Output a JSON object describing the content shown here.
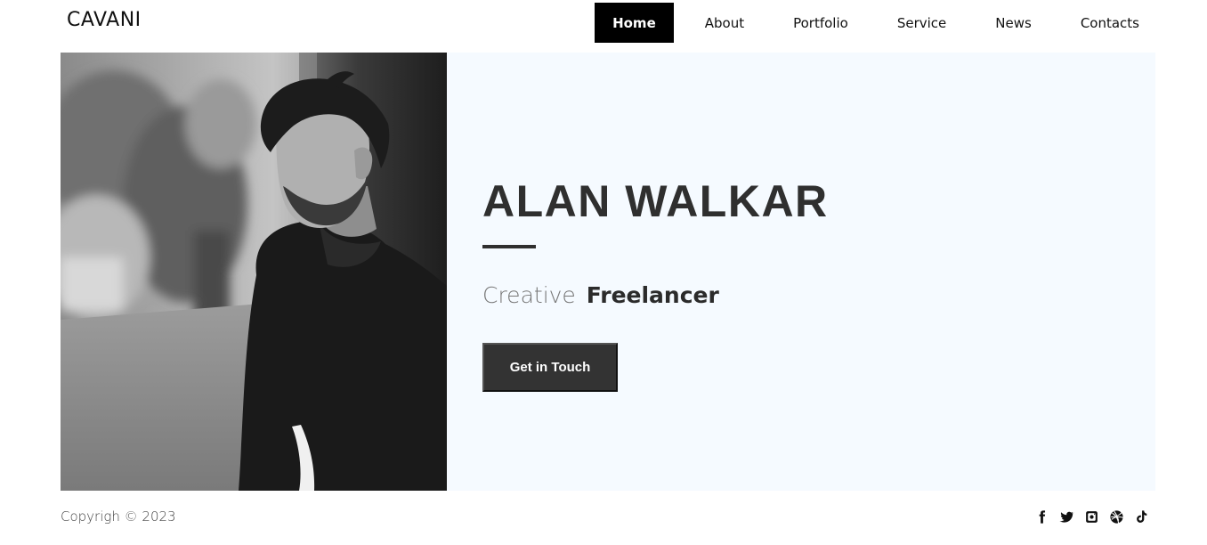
{
  "brand": {
    "name": "CAVANI"
  },
  "nav": {
    "items": [
      {
        "label": "Home",
        "active": true
      },
      {
        "label": "About"
      },
      {
        "label": "Portfolio"
      },
      {
        "label": "Service"
      },
      {
        "label": "News"
      },
      {
        "label": "Contacts"
      }
    ]
  },
  "hero": {
    "name": "ALAN WALKAR",
    "role_light": "Creative",
    "role_strong": "Freelancer",
    "cta_label": "Get in Touch"
  },
  "footer": {
    "copyright": "Copyrigh © 2023",
    "socials": [
      "facebook-icon",
      "twitter-icon",
      "instagram-icon",
      "dribbble-icon",
      "tiktok-icon"
    ]
  },
  "colors": {
    "nav_active_bg": "#000000",
    "hero_panel_bg": "#f5faff",
    "heading": "#2f2f2f",
    "button_bg": "#333333"
  }
}
